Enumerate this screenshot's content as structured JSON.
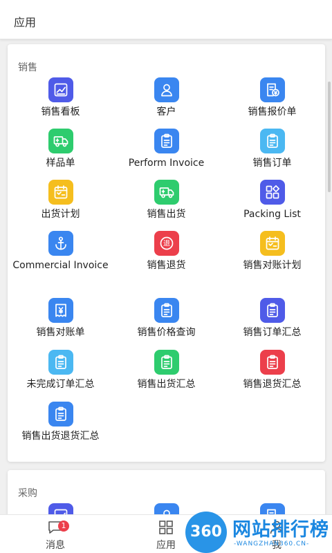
{
  "header": {
    "title": "应用"
  },
  "sections": [
    {
      "title": "销售",
      "items": [
        {
          "label": "销售看板",
          "icon": "chart-icon",
          "color": "#4f5be8"
        },
        {
          "label": "客户",
          "icon": "person-icon",
          "color": "#3a86f0"
        },
        {
          "label": "销售报价单",
          "icon": "quote-icon",
          "color": "#3a86f0"
        },
        {
          "label": "样品单",
          "icon": "truck-icon",
          "color": "#2ecc6e"
        },
        {
          "label": "Perform Invoice",
          "icon": "clipboard-icon",
          "color": "#3a86f0"
        },
        {
          "label": "销售订单",
          "icon": "clipboard-icon",
          "color": "#4bb8f2"
        },
        {
          "label": "出货计划",
          "icon": "calendar-icon",
          "color": "#f5be1e"
        },
        {
          "label": "销售出货",
          "icon": "truck-icon",
          "color": "#2ecc6e"
        },
        {
          "label": "Packing List",
          "icon": "grid-icon",
          "color": "#4f5be8"
        },
        {
          "label": "Commercial Invoice",
          "icon": "anchor-icon",
          "color": "#3a86f0"
        },
        {
          "label": "销售退货",
          "icon": "return-icon",
          "color": "#ec3f4b"
        },
        {
          "label": "销售对账计划",
          "icon": "calendar-icon",
          "color": "#f5be1e"
        },
        {
          "label": "销售对账单",
          "icon": "receipt-icon",
          "color": "#3a86f0"
        },
        {
          "label": "销售价格查询",
          "icon": "clipboard-icon",
          "color": "#3a86f0"
        },
        {
          "label": "销售订单汇总",
          "icon": "clipboard-icon",
          "color": "#4f5be8"
        },
        {
          "label": "未完成订单汇总",
          "icon": "clipboard-icon",
          "color": "#4bb8f2"
        },
        {
          "label": "销售出货汇总",
          "icon": "clipboard-icon",
          "color": "#2ecc6e"
        },
        {
          "label": "销售退货汇总",
          "icon": "clipboard-icon",
          "color": "#ec3f4b"
        },
        {
          "label": "销售出货退货汇总",
          "icon": "clipboard-icon",
          "color": "#3a86f0"
        }
      ]
    },
    {
      "title": "采购",
      "items": [
        {
          "label": "",
          "icon": "chart-icon",
          "color": "#4f5be8"
        },
        {
          "label": "",
          "icon": "person-icon",
          "color": "#3a86f0"
        },
        {
          "label": "",
          "icon": "quote-icon",
          "color": "#3a86f0"
        }
      ]
    }
  ],
  "tabbar": {
    "tabs": [
      {
        "label": "消息",
        "icon": "message-icon",
        "badge": "1"
      },
      {
        "label": "应用",
        "icon": "apps-icon"
      },
      {
        "label": "我",
        "icon": "user-icon"
      }
    ]
  },
  "watermark": {
    "logo": "360",
    "text": "网站排行榜",
    "sub": "-WANGZHAN360.CN-"
  }
}
